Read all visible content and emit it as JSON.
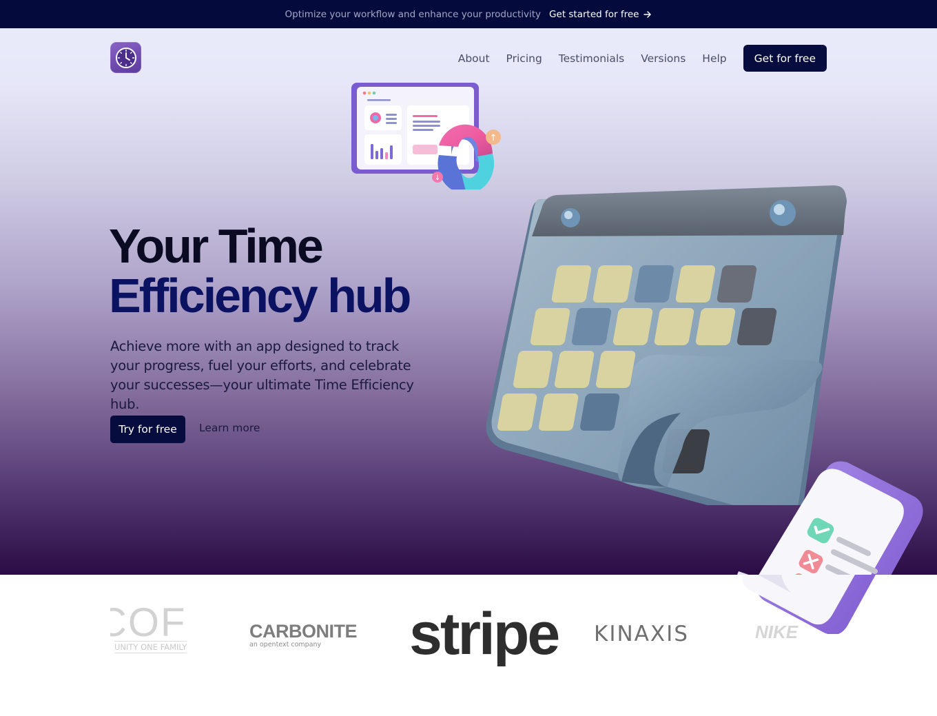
{
  "announcement": {
    "message": "Optimize your workflow and enhance your productivity",
    "cta_label": "Get started for free",
    "cta_icon": "arrow-right-icon"
  },
  "header": {
    "logo_icon": "clock-icon",
    "nav": [
      {
        "label": "About"
      },
      {
        "label": "Pricing"
      },
      {
        "label": "Testimonials"
      },
      {
        "label": "Versions"
      },
      {
        "label": "Help"
      }
    ],
    "cta_label": "Get for free"
  },
  "hero": {
    "title_line1": "Your Time",
    "title_line2": "Efficiency hub",
    "subtitle": "Achieve more with an app designed to track your progress, fuel your efforts, and celebrate your successes—your ultimate Time Efficiency hub.",
    "primary_cta": "Try for free",
    "secondary_cta": "Learn more",
    "illustrations": [
      "dashboard-illustration",
      "calendar-illustration",
      "checklist-illustration"
    ]
  },
  "logos": [
    {
      "name": "COF",
      "tagline": "UNITY ONE FAMILY"
    },
    {
      "name": "CARBONITE",
      "tagline": "an opentext company"
    },
    {
      "name": "stripe",
      "tagline": ""
    },
    {
      "name": "KINAXIS",
      "tagline": ""
    },
    {
      "name": "NIKE",
      "tagline": ""
    }
  ],
  "colors": {
    "navy": "#060c3e",
    "accent_purple": "#7b52c2",
    "title_blue": "#0b1261"
  }
}
